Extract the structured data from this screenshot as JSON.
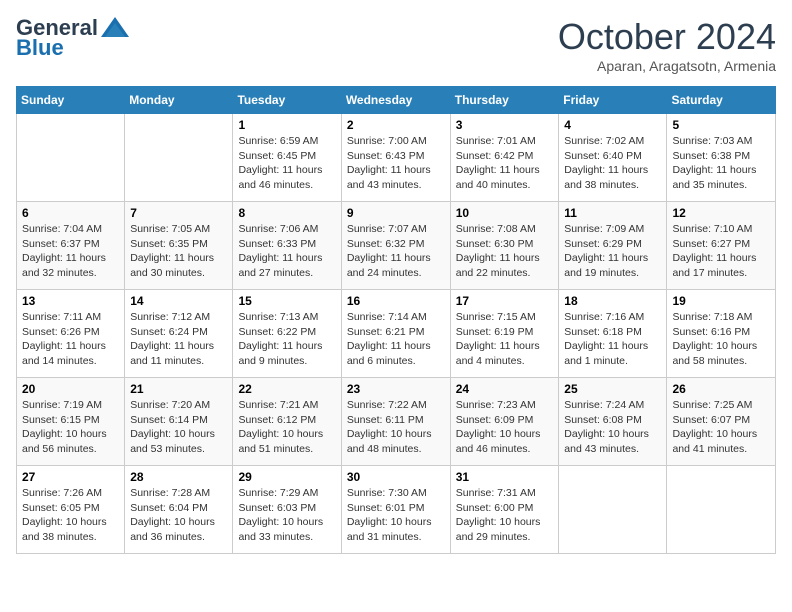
{
  "header": {
    "logo_line1": "General",
    "logo_line2": "Blue",
    "month_title": "October 2024",
    "subtitle": "Aparan, Aragatsotn, Armenia"
  },
  "weekdays": [
    "Sunday",
    "Monday",
    "Tuesday",
    "Wednesday",
    "Thursday",
    "Friday",
    "Saturday"
  ],
  "weeks": [
    [
      {
        "day": "",
        "info": ""
      },
      {
        "day": "",
        "info": ""
      },
      {
        "day": "1",
        "info": "Sunrise: 6:59 AM\nSunset: 6:45 PM\nDaylight: 11 hours and 46 minutes."
      },
      {
        "day": "2",
        "info": "Sunrise: 7:00 AM\nSunset: 6:43 PM\nDaylight: 11 hours and 43 minutes."
      },
      {
        "day": "3",
        "info": "Sunrise: 7:01 AM\nSunset: 6:42 PM\nDaylight: 11 hours and 40 minutes."
      },
      {
        "day": "4",
        "info": "Sunrise: 7:02 AM\nSunset: 6:40 PM\nDaylight: 11 hours and 38 minutes."
      },
      {
        "day": "5",
        "info": "Sunrise: 7:03 AM\nSunset: 6:38 PM\nDaylight: 11 hours and 35 minutes."
      }
    ],
    [
      {
        "day": "6",
        "info": "Sunrise: 7:04 AM\nSunset: 6:37 PM\nDaylight: 11 hours and 32 minutes."
      },
      {
        "day": "7",
        "info": "Sunrise: 7:05 AM\nSunset: 6:35 PM\nDaylight: 11 hours and 30 minutes."
      },
      {
        "day": "8",
        "info": "Sunrise: 7:06 AM\nSunset: 6:33 PM\nDaylight: 11 hours and 27 minutes."
      },
      {
        "day": "9",
        "info": "Sunrise: 7:07 AM\nSunset: 6:32 PM\nDaylight: 11 hours and 24 minutes."
      },
      {
        "day": "10",
        "info": "Sunrise: 7:08 AM\nSunset: 6:30 PM\nDaylight: 11 hours and 22 minutes."
      },
      {
        "day": "11",
        "info": "Sunrise: 7:09 AM\nSunset: 6:29 PM\nDaylight: 11 hours and 19 minutes."
      },
      {
        "day": "12",
        "info": "Sunrise: 7:10 AM\nSunset: 6:27 PM\nDaylight: 11 hours and 17 minutes."
      }
    ],
    [
      {
        "day": "13",
        "info": "Sunrise: 7:11 AM\nSunset: 6:26 PM\nDaylight: 11 hours and 14 minutes."
      },
      {
        "day": "14",
        "info": "Sunrise: 7:12 AM\nSunset: 6:24 PM\nDaylight: 11 hours and 11 minutes."
      },
      {
        "day": "15",
        "info": "Sunrise: 7:13 AM\nSunset: 6:22 PM\nDaylight: 11 hours and 9 minutes."
      },
      {
        "day": "16",
        "info": "Sunrise: 7:14 AM\nSunset: 6:21 PM\nDaylight: 11 hours and 6 minutes."
      },
      {
        "day": "17",
        "info": "Sunrise: 7:15 AM\nSunset: 6:19 PM\nDaylight: 11 hours and 4 minutes."
      },
      {
        "day": "18",
        "info": "Sunrise: 7:16 AM\nSunset: 6:18 PM\nDaylight: 11 hours and 1 minute."
      },
      {
        "day": "19",
        "info": "Sunrise: 7:18 AM\nSunset: 6:16 PM\nDaylight: 10 hours and 58 minutes."
      }
    ],
    [
      {
        "day": "20",
        "info": "Sunrise: 7:19 AM\nSunset: 6:15 PM\nDaylight: 10 hours and 56 minutes."
      },
      {
        "day": "21",
        "info": "Sunrise: 7:20 AM\nSunset: 6:14 PM\nDaylight: 10 hours and 53 minutes."
      },
      {
        "day": "22",
        "info": "Sunrise: 7:21 AM\nSunset: 6:12 PM\nDaylight: 10 hours and 51 minutes."
      },
      {
        "day": "23",
        "info": "Sunrise: 7:22 AM\nSunset: 6:11 PM\nDaylight: 10 hours and 48 minutes."
      },
      {
        "day": "24",
        "info": "Sunrise: 7:23 AM\nSunset: 6:09 PM\nDaylight: 10 hours and 46 minutes."
      },
      {
        "day": "25",
        "info": "Sunrise: 7:24 AM\nSunset: 6:08 PM\nDaylight: 10 hours and 43 minutes."
      },
      {
        "day": "26",
        "info": "Sunrise: 7:25 AM\nSunset: 6:07 PM\nDaylight: 10 hours and 41 minutes."
      }
    ],
    [
      {
        "day": "27",
        "info": "Sunrise: 7:26 AM\nSunset: 6:05 PM\nDaylight: 10 hours and 38 minutes."
      },
      {
        "day": "28",
        "info": "Sunrise: 7:28 AM\nSunset: 6:04 PM\nDaylight: 10 hours and 36 minutes."
      },
      {
        "day": "29",
        "info": "Sunrise: 7:29 AM\nSunset: 6:03 PM\nDaylight: 10 hours and 33 minutes."
      },
      {
        "day": "30",
        "info": "Sunrise: 7:30 AM\nSunset: 6:01 PM\nDaylight: 10 hours and 31 minutes."
      },
      {
        "day": "31",
        "info": "Sunrise: 7:31 AM\nSunset: 6:00 PM\nDaylight: 10 hours and 29 minutes."
      },
      {
        "day": "",
        "info": ""
      },
      {
        "day": "",
        "info": ""
      }
    ]
  ]
}
